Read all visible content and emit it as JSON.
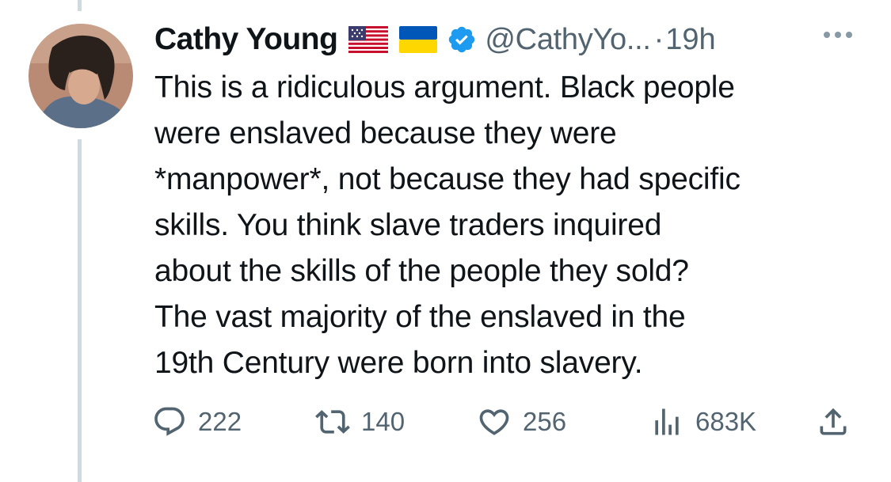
{
  "tweet": {
    "display_name": "Cathy Young",
    "handle": "@CathyYo...",
    "separator": "·",
    "time": "19h",
    "badges": [
      "us-flag-icon",
      "ukraine-flag-icon",
      "verified-badge-icon"
    ],
    "text_lines": [
      "This is a ridiculous argument. Black people",
      "were enslaved because they were",
      "*manpower*, not because they had specific",
      "skills. You think slave traders inquired",
      "about the skills of the people they sold?",
      "The vast majority of the enslaved in the",
      "19th Century were born into slavery."
    ]
  },
  "actions": {
    "reply": {
      "icon": "reply-icon",
      "count": "222"
    },
    "retweet": {
      "icon": "retweet-icon",
      "count": "140"
    },
    "like": {
      "icon": "heart-icon",
      "count": "256"
    },
    "views": {
      "icon": "views-chart-icon",
      "count": "683K"
    },
    "share": {
      "icon": "share-icon"
    }
  },
  "colors": {
    "text": "#0f1419",
    "secondary": "#536471",
    "verified": "#1d9bf0",
    "thread_line": "#cfd9de"
  }
}
